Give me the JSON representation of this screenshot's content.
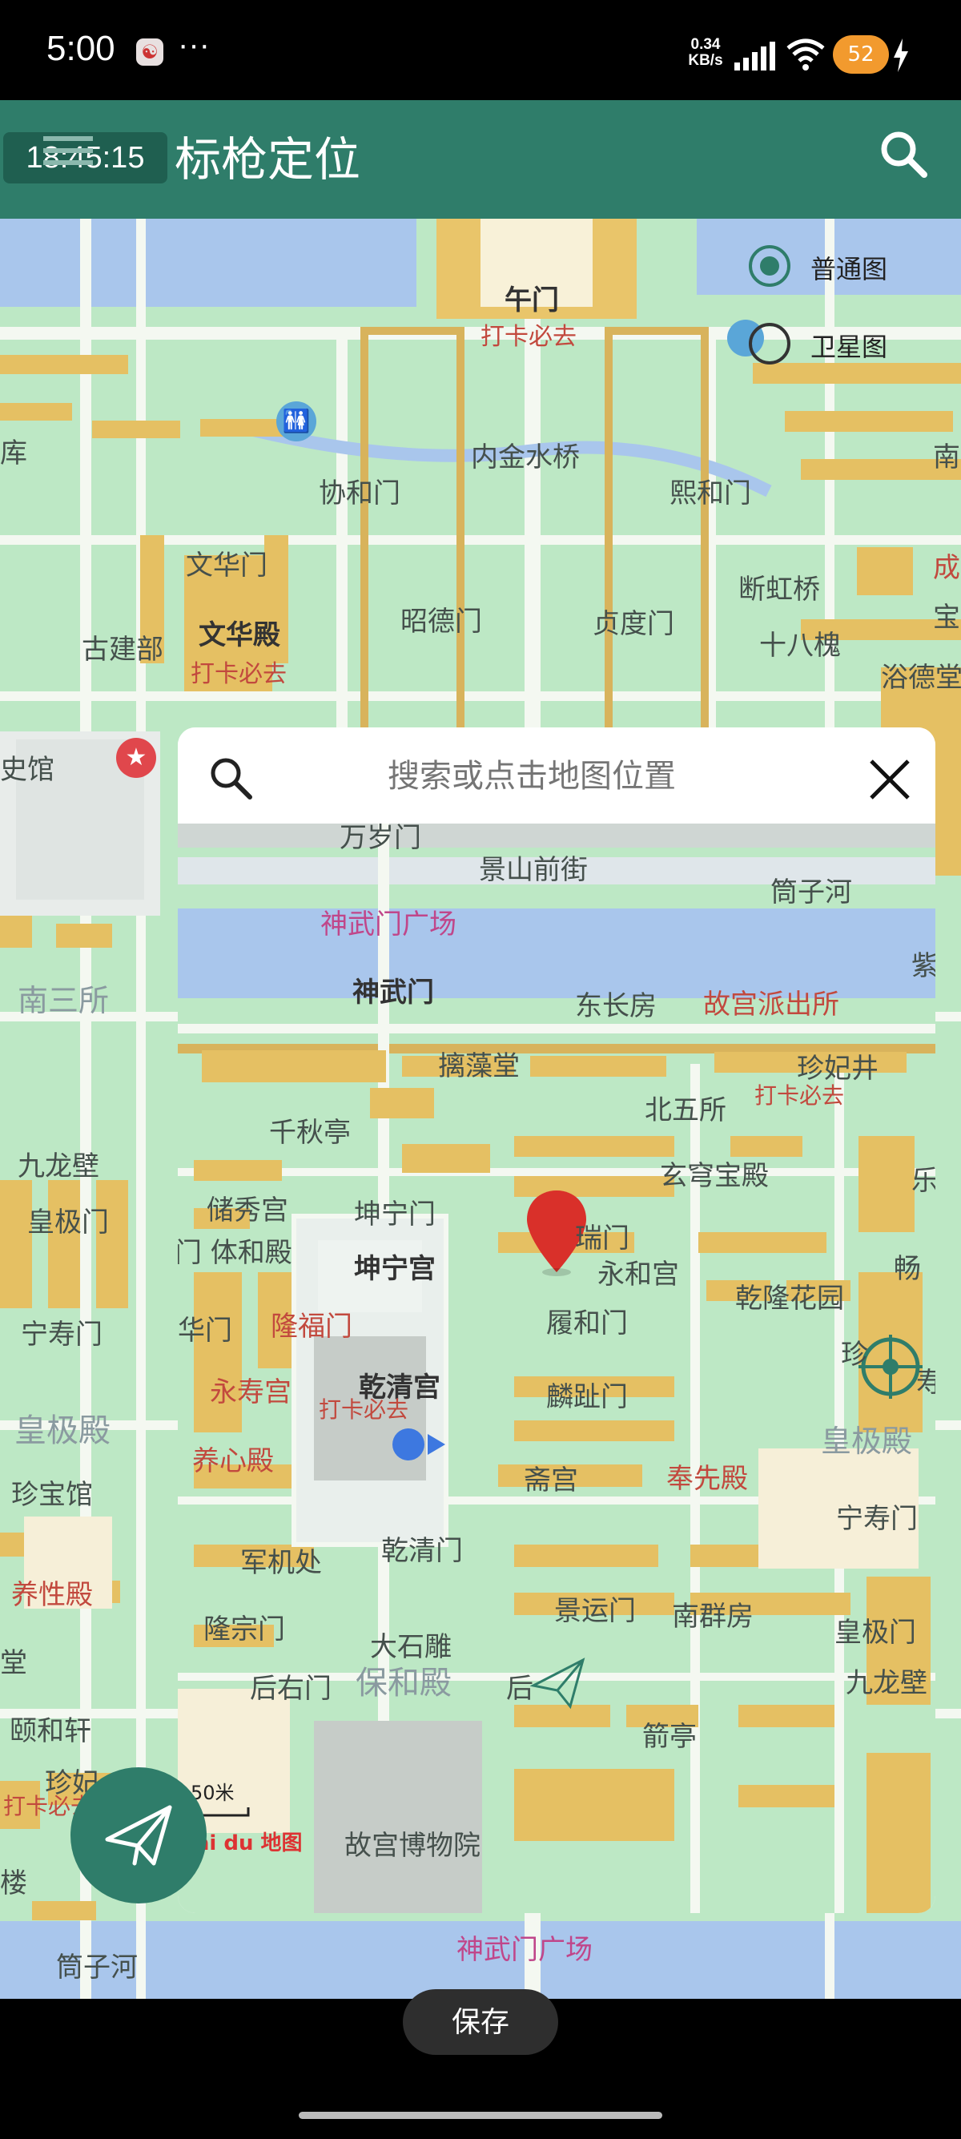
{
  "status_bar": {
    "time": "5:00",
    "more": "···",
    "net_speed_value": "0.34",
    "net_speed_unit": "KB/s",
    "battery": "52"
  },
  "header": {
    "time_badge": "18:45:15",
    "title": "标枪定位"
  },
  "map_type": {
    "normal_label": "普通图",
    "satellite_label": "卫星图",
    "selected": "普通图"
  },
  "bg_labels": {
    "wumen": "午门",
    "daka1": "打卡必去",
    "neijinshuiqiao": "内金水桥",
    "xiehemen": "协和门",
    "xihemen": "熙和门",
    "wenhuamen": "文华门",
    "duanhongqiao": "断虹桥",
    "guijianbu": "古建部",
    "wenhuadian": "文华殿",
    "daka2": "打卡必去",
    "zhaodemen": "昭德门",
    "zhendumen": "贞度门",
    "shibahuai": "十八槐",
    "yudetang": "浴德堂",
    "shiguan": "史馆",
    "nansansuo": "南三所",
    "jiulongbi": "九龙壁",
    "huangjimen": "皇极门",
    "ningshoumen": "宁寿门",
    "huangjidian": "皇极殿",
    "zhenbaoguan": "珍宝馆",
    "yangxingdian": "养性殿",
    "yiheixuan": "颐和轩",
    "zhenfei": "珍妃",
    "tongzihe": "筒子河",
    "shenwumen_plaza": "神武门广场",
    "ku": "库",
    "nan": "南",
    "cheng": "成",
    "bao": "宝",
    "tang": "堂",
    "lou": "楼",
    "daka3": "打卡必去"
  },
  "dialog": {
    "search_placeholder": "搜索或点击地图位置",
    "labels": {
      "wansuimen": "万岁门",
      "jingshanqianjie": "景山前街",
      "tongzihe": "筒子河",
      "shenwumen_plaza": "神武门广场",
      "shenwumen": "神武门",
      "dongchangfang": "东长房",
      "paichusuo": "故宫派出所",
      "zi": "紫",
      "chizaotang": "摛藻堂",
      "zhenfeijing": "珍妃井",
      "daka": "打卡必去",
      "beiwusuo": "北五所",
      "qianqiuting": "千秋亭",
      "xuanqiongbaodian": "玄穹宝殿",
      "le": "乐",
      "chuxiugong": "储秀宫",
      "kunningmen": "坤宁门",
      "ruimen": "瑞门",
      "tihedian": "门 体和殿",
      "kunninggong": "坤宁宫",
      "yonghegong": "永和宫",
      "qianlonghuayuan": "乾隆花园",
      "chang": "畅",
      "huamen": "华门",
      "longfumen": "隆福门",
      "lühemen": "履和门",
      "zhen": "珍",
      "yongshougong": "永寿宫",
      "qianqinggong": "乾清宫",
      "linzhimen": "麟趾门",
      "huangjidian": "皇极殿",
      "shou": "寿",
      "daka2": "打卡必去",
      "yangxindian": "养心殿",
      "zhaigong": "斋宫",
      "fengxiandian": "奉先殿",
      "ningshoumen": "宁寿门",
      "junjichu": "军机处",
      "qianqingmen": "乾清门",
      "jingyunmen": "景运门",
      "nanqunfang": "南群房",
      "longzongmen": "隆宗门",
      "huangjimen": "皇极门",
      "dashidiao": "大石雕",
      "jiulongbi": "九龙壁",
      "houyoumen": "后右门",
      "baohedian": "保和殿",
      "houzuomen": "后",
      "jianting": "箭亭",
      "scale": "50米",
      "baidu": "Bai du 地图",
      "gugongbowuyuan": "故宫博物院"
    }
  },
  "save_label": "保存"
}
